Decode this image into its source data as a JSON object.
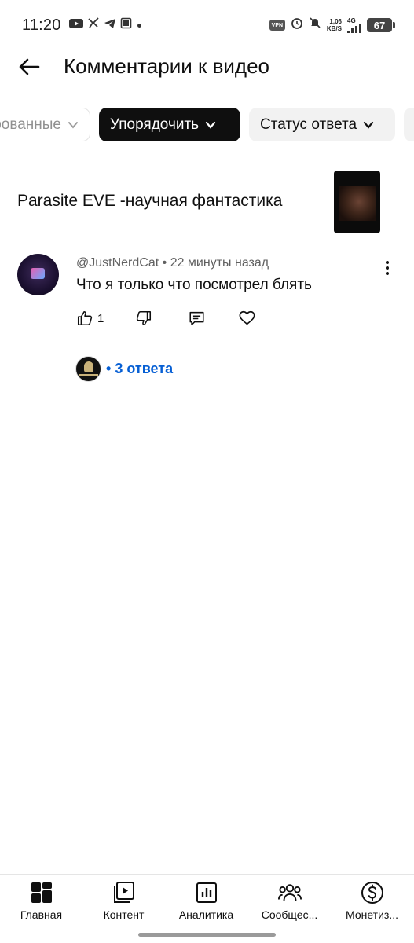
{
  "status_bar": {
    "time": "11:20",
    "notification_icons": [
      "youtube-icon",
      "bird-icon",
      "telegram-icon",
      "screenshot-icon"
    ],
    "vpn": "VPN",
    "net_speed_value": "1,06",
    "net_speed_unit": "KB/S",
    "network": "4G",
    "battery": "67"
  },
  "header": {
    "title": "Комментарии к видео"
  },
  "chips": [
    {
      "label": "рованные"
    },
    {
      "label": "Упорядочить"
    },
    {
      "label": "Статус ответа"
    }
  ],
  "video": {
    "title": "Parasite EVE -научная фантастика"
  },
  "comment": {
    "author": "@JustNerdCat",
    "time": "22 минуты назад",
    "separator": "•",
    "text": "Что я только что посмотрел блять",
    "likes": "1"
  },
  "replies": {
    "prefix": "•",
    "label": "3 ответа"
  },
  "bottom_nav": [
    {
      "label": "Главная",
      "icon": "home-grid-icon"
    },
    {
      "label": "Контент",
      "icon": "content-play-icon"
    },
    {
      "label": "Аналитика",
      "icon": "analytics-chart-icon"
    },
    {
      "label": "Сообщес...",
      "icon": "community-icon"
    },
    {
      "label": "Монетиз...",
      "icon": "monetization-dollar-icon"
    }
  ]
}
